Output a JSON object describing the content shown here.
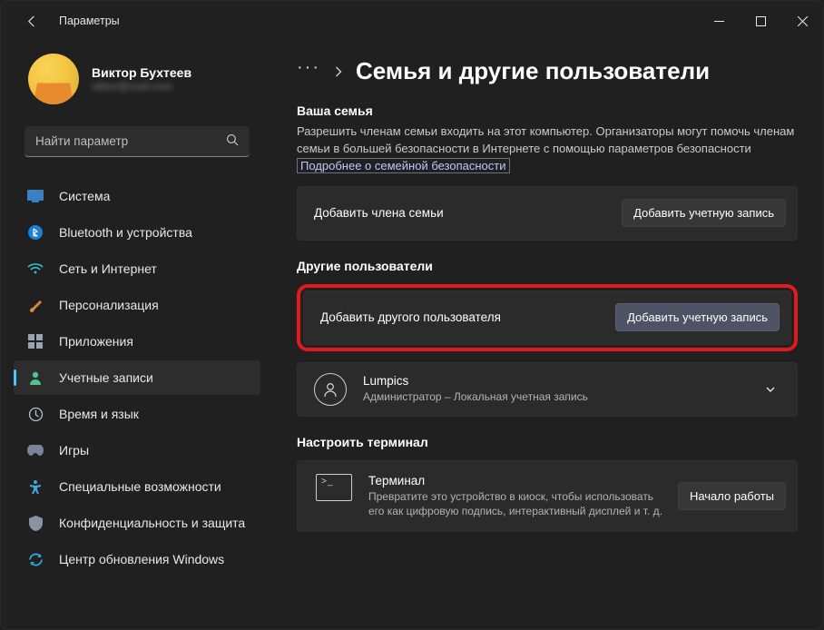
{
  "window": {
    "title": "Параметры"
  },
  "profile": {
    "name": "Виктор Бухтеев",
    "email": "viktor@mail.com"
  },
  "search": {
    "placeholder": "Найти параметр"
  },
  "sidebar": {
    "items": [
      {
        "label": "Система"
      },
      {
        "label": "Bluetooth и устройства"
      },
      {
        "label": "Сеть и Интернет"
      },
      {
        "label": "Персонализация"
      },
      {
        "label": "Приложения"
      },
      {
        "label": "Учетные записи"
      },
      {
        "label": "Время и язык"
      },
      {
        "label": "Игры"
      },
      {
        "label": "Специальные возможности"
      },
      {
        "label": "Конфиденциальность и защита"
      },
      {
        "label": "Центр обновления Windows"
      }
    ]
  },
  "breadcrumb": {
    "dots": "···",
    "title": "Семья и другие пользователи"
  },
  "family": {
    "heading": "Ваша семья",
    "desc_pre": "Разрешить членам семьи входить на этот компьютер. Организаторы могут помочь членам семьи в большей безопасности в Интернете с помощью параметров безопасности ",
    "link": "Подробнее о семейной безопасности",
    "add_label": "Добавить члена семьи",
    "add_btn": "Добавить учетную запись"
  },
  "others": {
    "heading": "Другие пользователи",
    "add_label": "Добавить другого пользователя",
    "add_btn": "Добавить учетную запись",
    "user_name": "Lumpics",
    "user_sub": "Администратор – Локальная учетная запись"
  },
  "terminal": {
    "heading": "Настроить терминал",
    "title": "Терминал",
    "desc": "Превратите это устройство в киоск, чтобы использовать его как цифровую подпись, интерактивный дисплей и т. д.",
    "btn": "Начало работы"
  }
}
